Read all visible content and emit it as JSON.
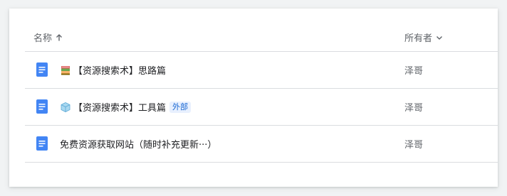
{
  "header": {
    "name_label": "名称",
    "sort_icon": "arrow-up-icon",
    "owner_label": "所有者",
    "owner_dropdown_icon": "chevron-down-icon"
  },
  "files": [
    {
      "title": "【资源搜索术】思路篇",
      "emoji_icon": "books-icon",
      "badge": "",
      "owner": "泽哥",
      "doc_icon": "google-docs-icon"
    },
    {
      "title": "【资源搜索术】工具篇",
      "emoji_icon": "ice-cube-icon",
      "badge": "外部",
      "owner": "泽哥",
      "doc_icon": "google-docs-icon"
    },
    {
      "title": "免费资源获取网站（随时补充更新···）",
      "emoji_icon": "",
      "badge": "",
      "owner": "泽哥",
      "doc_icon": "google-docs-icon"
    }
  ],
  "colors": {
    "doc_blue": "#4285f4",
    "badge_bg": "#e8f0fe",
    "badge_text": "#1967d2",
    "divider": "#dadce0",
    "secondary_text": "#5f6368"
  }
}
